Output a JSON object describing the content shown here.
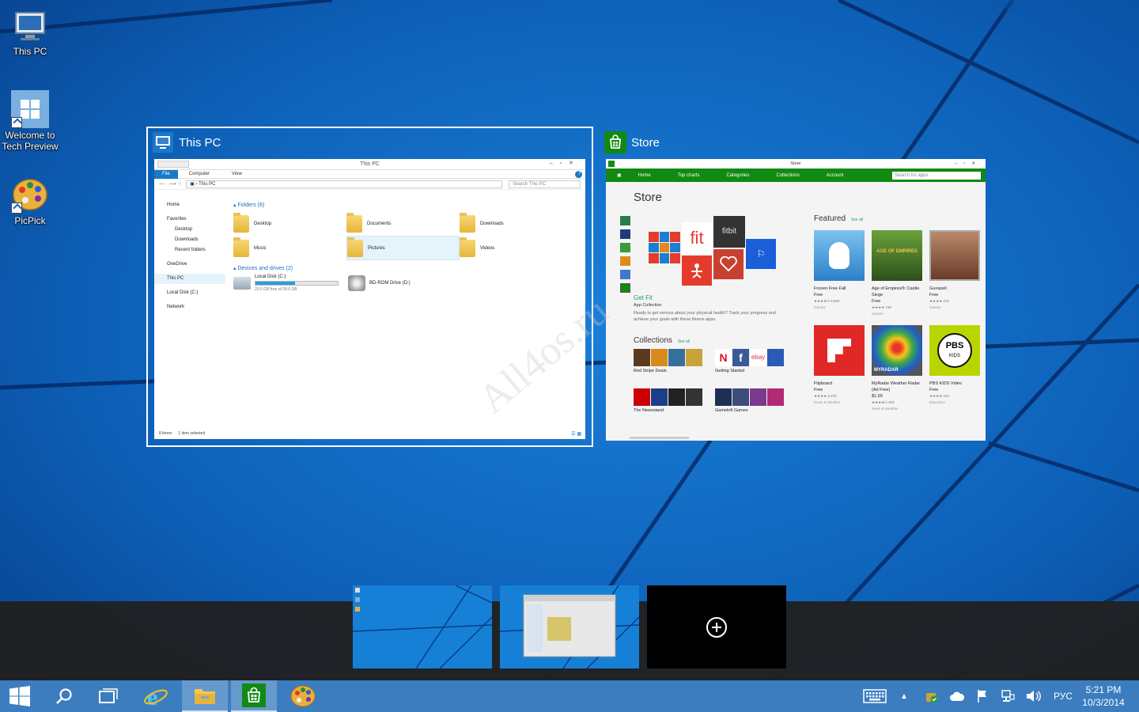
{
  "desktop": {
    "icons": [
      {
        "label": "This PC"
      },
      {
        "label": "Welcome to Tech Preview"
      },
      {
        "label": "PicPick"
      }
    ]
  },
  "task_view": {
    "windows": [
      {
        "title": "This PC",
        "explorer": {
          "window_title": "This PC",
          "ribbon_tabs": [
            "File",
            "Computer",
            "View"
          ],
          "address": "This PC",
          "search_placeholder": "Search This PC",
          "nav": [
            "Home",
            "Favorites",
            "Desktop",
            "Downloads",
            "Recent folders",
            "OneDrive",
            "This PC",
            "Local Disk (C:)",
            "Network"
          ],
          "folders_header": "Folders (6)",
          "folders": [
            "Desktop",
            "Documents",
            "Downloads",
            "Music",
            "Pictures",
            "Videos"
          ],
          "devices_header": "Devices and drives (2)",
          "drive_c_name": "Local Disk (C:)",
          "drive_c_free": "20.5 GB free of 39.6 GB",
          "drive_c_used_fraction": 0.48,
          "drive_d_name": "BD-ROM Drive (D:)",
          "status_items": "8 items",
          "status_selected": "1 item selected"
        }
      },
      {
        "title": "Store",
        "store": {
          "window_title": "Store",
          "nav": [
            "Home",
            "Top charts",
            "Categories",
            "Collections",
            "Account"
          ],
          "search_placeholder": "Search for apps",
          "page_title": "Store",
          "hero_title": "Get Fit",
          "hero_sub": "App Collection",
          "hero_desc": "Ready to get serious about your physical health? Track your progress and achieve your goals with these fitness apps.",
          "tile_fit": "fit",
          "tile_fitbit": "fitbit",
          "featured_header": "Featured",
          "see_all": "See all",
          "collections_header": "Collections",
          "collections": [
            "Red Stripe Deals",
            "Getting Started",
            "The Newsstand",
            "Gameloft Games"
          ],
          "apps": [
            {
              "name": "Frozen Free Fall",
              "price": "Free",
              "rating": "★★★★½ 9,056",
              "category": "Games"
            },
            {
              "name": "Age of Empires®: Castle Siege",
              "price": "Free",
              "rating": "★★★★ 739",
              "category": "Games"
            },
            {
              "name": "Gunspell",
              "price": "Free",
              "rating": "★★★★ 272",
              "category": "Games"
            },
            {
              "name": "Flipboard",
              "price": "Free",
              "rating": "★★★★ 5,275",
              "category": "News & Weather"
            },
            {
              "name": "MyRadar Weather Radar (Ad Free)",
              "price": "$1.99",
              "rating": "★★★★½ 403",
              "category": "News & Weather"
            },
            {
              "name": "PBS KIDS Video",
              "price": "Free",
              "rating": "★★★★ 102",
              "category": "Education"
            }
          ],
          "tile_myradar": "MYRADAR",
          "tile_pbs": "PBS",
          "tile_pbs_kids": "KIDS",
          "tile_aoe": "AGE OF EMPIRES"
        }
      }
    ],
    "watermark": "All4os.ru"
  },
  "taskbar": {
    "language": "РУС",
    "time": "5:21 PM",
    "date": "10/3/2014"
  },
  "colors": {
    "accent": "#1979ca",
    "store_green": "#118a12",
    "taskbar": "#3c7dbf"
  }
}
